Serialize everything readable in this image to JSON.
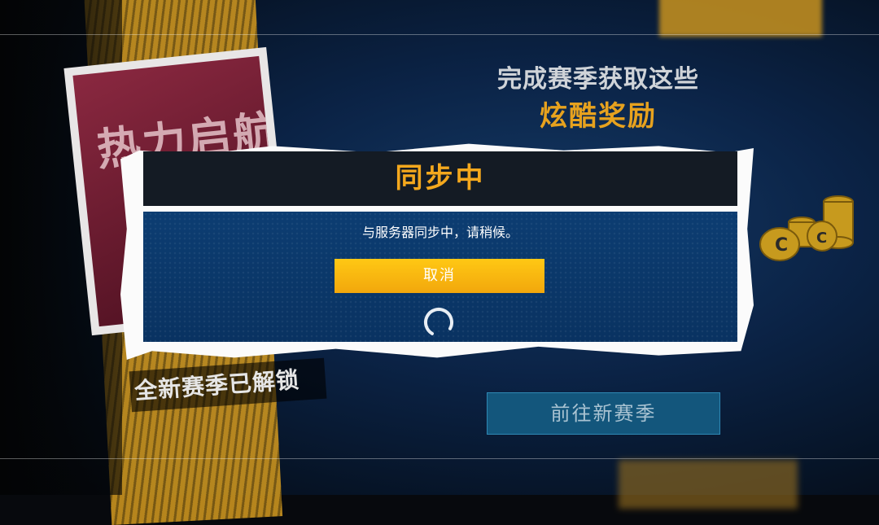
{
  "background": {
    "card_title": "热力启航",
    "promo_line1": "完成赛季获取这些",
    "promo_line2": "炫酷奖励",
    "unlock_text": "全新赛季已解锁",
    "goto_button": "前往新赛季"
  },
  "dialog": {
    "title": "同步中",
    "message": "与服务器同步中，请稍候。",
    "cancel_label": "取消"
  },
  "colors": {
    "accent": "#f4a81d",
    "button_yellow": "#ffc814",
    "dialog_blue": "#0b3a6e"
  }
}
